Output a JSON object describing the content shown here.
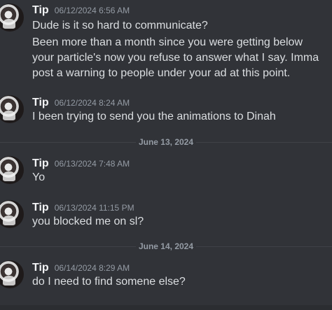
{
  "messages": [
    {
      "username": "Tip",
      "timestamp": "06/12/2024 6:56 AM",
      "lines": [
        "Dude is it so hard to communicate?",
        "Been more than a month since you were getting below your particle's now you refuse to answer what I say. Imma post a warning to people under your ad at this point."
      ]
    },
    {
      "username": "Tip",
      "timestamp": "06/12/2024 8:24 AM",
      "lines": [
        "I been trying to send you the animations to Dinah"
      ]
    },
    {
      "username": "Tip",
      "timestamp": "06/13/2024 7:48 AM",
      "lines": [
        "Yo"
      ]
    },
    {
      "username": "Tip",
      "timestamp": "06/13/2024 11:15 PM",
      "lines": [
        "you blocked me on sl?"
      ]
    },
    {
      "username": "Tip",
      "timestamp": "06/14/2024 8:29 AM",
      "lines": [
        "do I need to find somene else?"
      ]
    }
  ],
  "dividers": [
    "June 13, 2024",
    "June 14, 2024"
  ],
  "colors": {
    "background": "#313338",
    "username": "#f2f3f5",
    "timestamp": "#949ba4",
    "text": "#dbdee1",
    "divider_line": "#3f4147"
  }
}
